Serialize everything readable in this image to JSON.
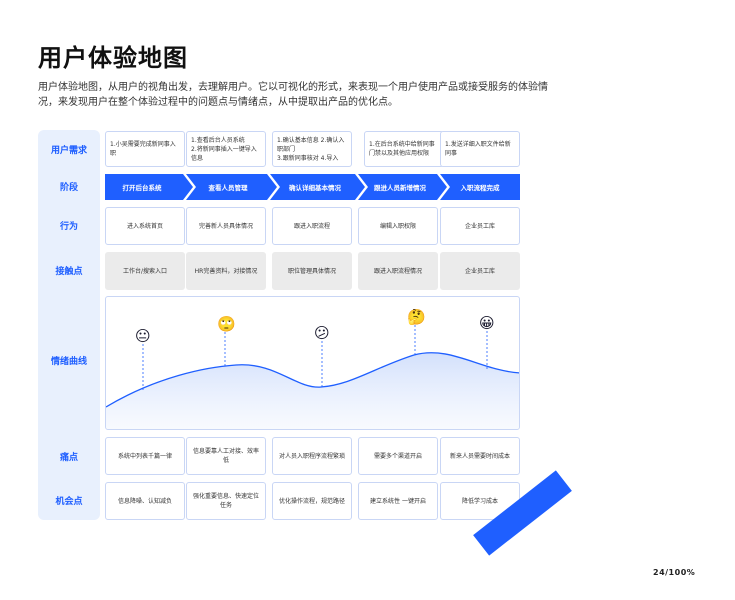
{
  "title": "用户体验地图",
  "description": "用户体验地图，从用户的视角出发，去理解用户。它以可视化的形式，来表现一个用户使用产品或接受服务的体验情况，来发现用户在整个体验过程中的问题点与情绪点，从中提取出产品的优化点。",
  "row_labels": {
    "needs": "用户需求",
    "stage": "阶段",
    "behavior": "行为",
    "touchpoint": "接触点",
    "emotion": "情绪曲线",
    "pain": "痛点",
    "opportunity": "机会点"
  },
  "needs": [
    "1.小吴需要完成新同事入职",
    "1.查看后台人员系统\n2.将新同事插入一键导入信息",
    "1.确认基本信息 2.确认入职部门\n3.跟新同事核对 4.导入",
    "1.在后台系统中给新同事\n门禁以及其他应用权限",
    "1.发送详细入职文件给新同事"
  ],
  "stages": [
    "打开后台系统",
    "查看人员管理",
    "确认详细基本情况",
    "跟进人员新增情况",
    "入职流程完成"
  ],
  "behaviors": [
    "进入系统首页",
    "完善新人员具体情况",
    "跟进入职流程",
    "编辑入职权限",
    "企业员工库"
  ],
  "touchpoints": [
    "工作台/搜索入口",
    "HR完善资料，对接情况",
    "职位管理具体情况",
    "跟进入职流程情况",
    "企业员工库"
  ],
  "emotions": [
    {
      "icon": "neutral-face-icon",
      "glyph": "😐"
    },
    {
      "icon": "eye-roll-face-icon",
      "glyph": "🙄"
    },
    {
      "icon": "confused-face-icon",
      "glyph": "😕"
    },
    {
      "icon": "thinking-face-icon",
      "glyph": "🤔"
    },
    {
      "icon": "happy-face-icon",
      "glyph": "😀"
    }
  ],
  "pains": [
    "系统中列表千篇一律",
    "信息要靠人工对接、效率低",
    "对人员入职程序流程繁琐",
    "需要多个渠道开启",
    "新来人员需要时间成本"
  ],
  "opportunities": [
    "信息降噪、认知减负",
    "强化重要信息、快速定位任务",
    "优化操作流程，规范路径",
    "建立系统性 一键开启",
    "降低学习成本"
  ],
  "page_number": "24/100%",
  "colors": {
    "accent": "#1f5fff",
    "label_bg": "#e8f0fd",
    "cell_border": "#c9d6f5",
    "gray_cell": "#ebebeb"
  }
}
